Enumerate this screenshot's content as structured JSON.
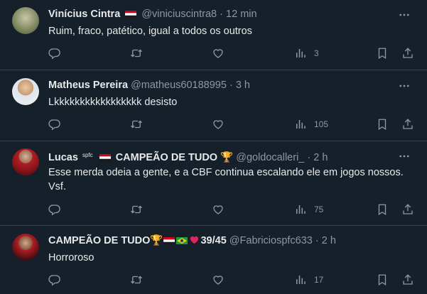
{
  "tweets": [
    {
      "name": "Vinícius Cintra",
      "handle": "@viniciuscintra8",
      "time": "12 min",
      "text": "Ruim, fraco, patético, igual a todos os outros",
      "views": "3"
    },
    {
      "name": "Matheus Pereira",
      "handle": "@matheus60188995",
      "time": "3 h",
      "text": "Lkkkkkkkkkkkkkkkkk desisto",
      "views": "105"
    },
    {
      "name": "Lucas",
      "name_suffix": "CAMPEÃO DE TUDO",
      "tiny_tag": "spfc",
      "handle": "@goldocalleri_",
      "time": "2 h",
      "text": "Esse merda odeia a gente, e a CBF continua escalando ele em jogos nossos. Vsf.",
      "views": "75"
    },
    {
      "name": "CAMPEÃO DE TUDO",
      "name_suffix": "39/45",
      "handle": "@Fabriciospfc633",
      "time": "2 h",
      "text": "Horroroso",
      "views": "17"
    }
  ],
  "separator": "·",
  "icons": {
    "reply": "reply-icon",
    "retweet": "retweet-icon",
    "like": "like-icon",
    "views": "views-icon",
    "bookmark": "bookmark-icon",
    "share": "share-icon",
    "more": "more-icon"
  },
  "colors": {
    "background": "#15202b",
    "text": "#e7e9ea",
    "muted": "#8b98a5",
    "border": "#38444d"
  }
}
